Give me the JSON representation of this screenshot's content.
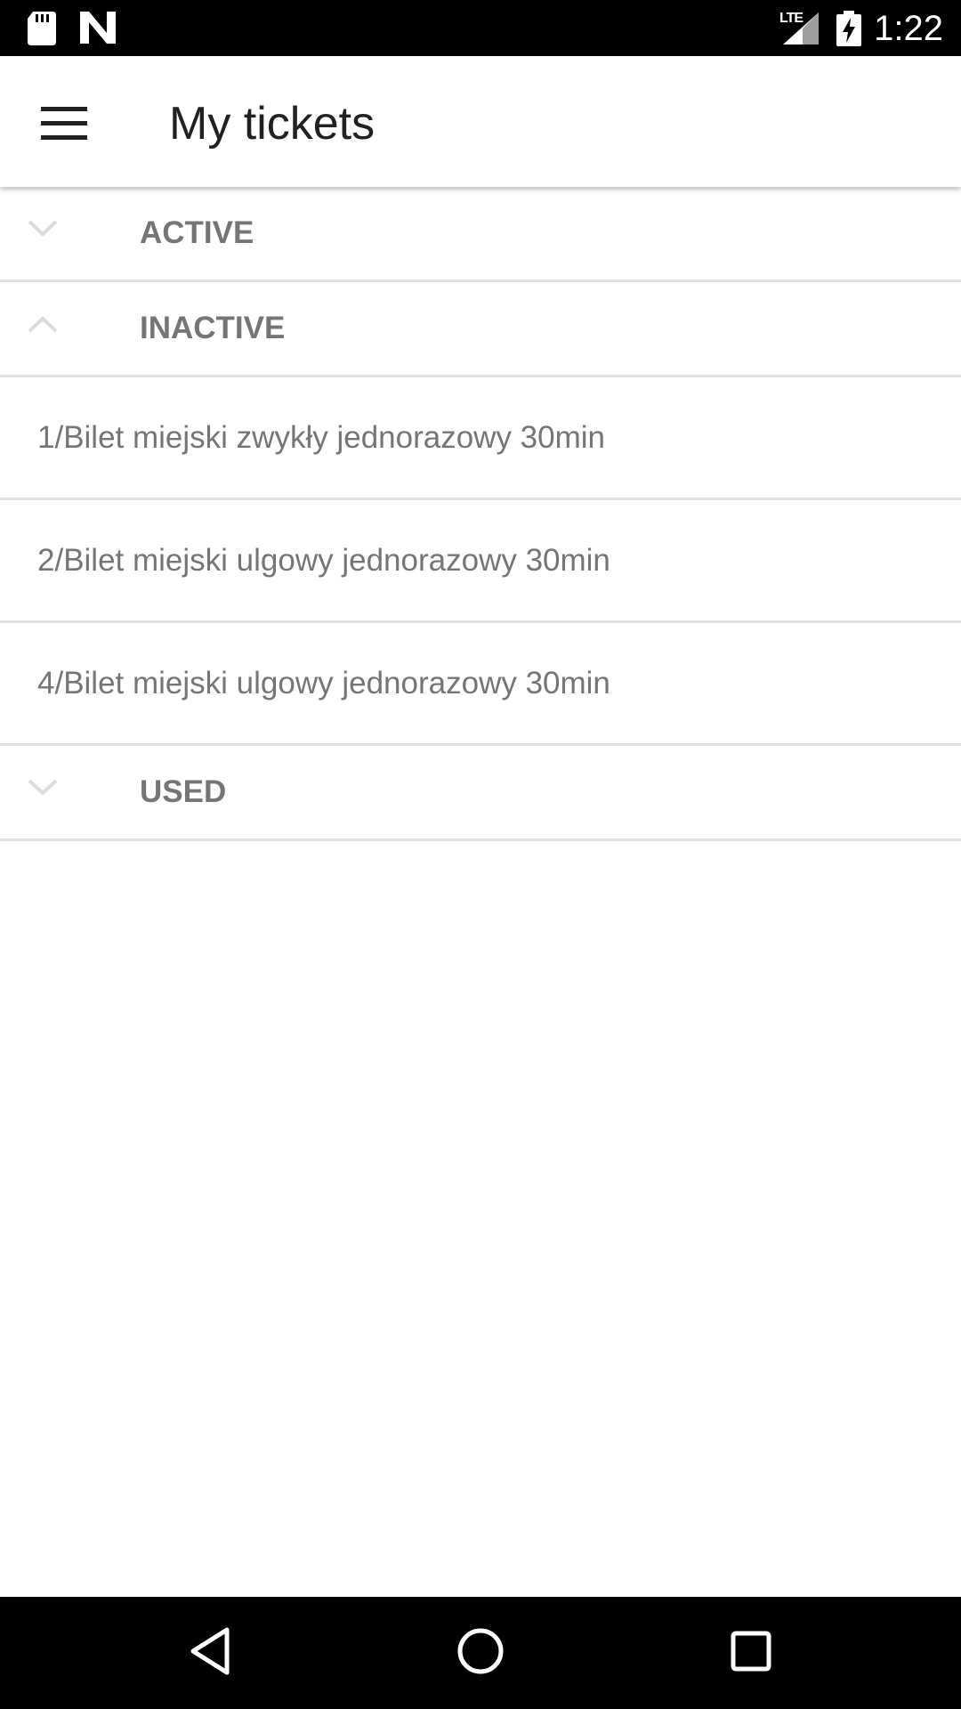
{
  "status_bar": {
    "network_label": "LTE",
    "time": "1:22",
    "icons": [
      "sd-card-icon",
      "n-notification-icon",
      "signal-icon",
      "battery-charging-icon"
    ]
  },
  "app_bar": {
    "title": "My tickets",
    "menu_icon": "hamburger-menu-icon"
  },
  "sections": [
    {
      "label": "ACTIVE",
      "expanded": false,
      "items": []
    },
    {
      "label": "INACTIVE",
      "expanded": true,
      "items": [
        "1/Bilet miejski zwykły jednorazowy 30min",
        "2/Bilet miejski ulgowy jednorazowy 30min",
        "4/Bilet miejski ulgowy jednorazowy 30min"
      ]
    },
    {
      "label": "USED",
      "expanded": false,
      "items": []
    }
  ],
  "nav_bar": {
    "icons": [
      "back-icon",
      "home-icon",
      "recents-icon"
    ]
  },
  "colors": {
    "status_bar_bg": "#000000",
    "app_bar_bg": "#ffffff",
    "title_text": "#212121",
    "section_text": "#757575",
    "item_text": "#757575",
    "divider": "#e0e0e0",
    "chevron": "#dcdcdc"
  }
}
